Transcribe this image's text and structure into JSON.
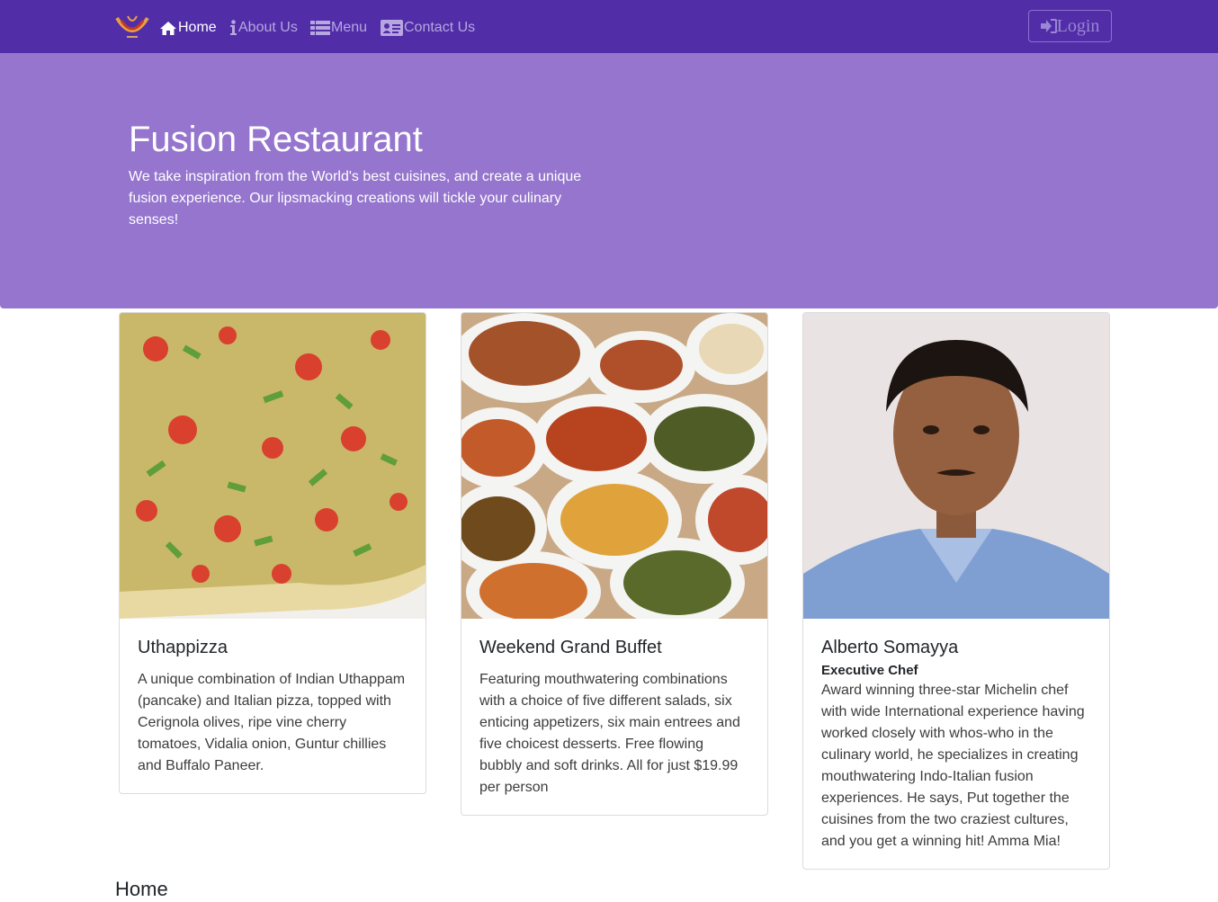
{
  "nav": {
    "items": [
      {
        "label": "Home",
        "icon": "home-icon",
        "active": true
      },
      {
        "label": "About Us",
        "icon": "info-icon",
        "active": false
      },
      {
        "label": "Menu",
        "icon": "list-icon",
        "active": false
      },
      {
        "label": "Contact Us",
        "icon": "address-card-icon",
        "active": false
      }
    ],
    "login_label": "Login",
    "colors": {
      "bar": "#512da8",
      "active": "#ffffff",
      "inactive": "#b7a6e0"
    }
  },
  "jumbotron": {
    "title": "Fusion Restaurant",
    "text": "We take inspiration from the World's best cuisines, and create a unique fusion experience. Our lipsmacking creations will tickle your culinary senses!",
    "color": "#9575cd"
  },
  "cards": [
    {
      "title": "Uthappizza",
      "subtitle": "",
      "text": "A unique combination of Indian Uthappam (pancake) and Italian pizza, topped with Cerignola olives, ripe vine cherry tomatoes, Vidalia onion, Guntur chillies and Buffalo Paneer."
    },
    {
      "title": "Weekend Grand Buffet",
      "subtitle": "",
      "text": "Featuring mouthwatering combinations with a choice of five different salads, six enticing appetizers, six main entrees and five choicest desserts. Free flowing bubbly and soft drinks. All for just $19.99 per person"
    },
    {
      "title": "Alberto Somayya",
      "subtitle": "Executive Chef",
      "text": "Award winning three-star Michelin chef with wide International experience having worked closely with whos-who in the culinary world, he specializes in creating mouthwatering Indo-Italian fusion experiences. He says, Put together the cuisines from the two craziest cultures, and you get a winning hit! Amma Mia!"
    }
  ],
  "section": {
    "title": "Home"
  }
}
